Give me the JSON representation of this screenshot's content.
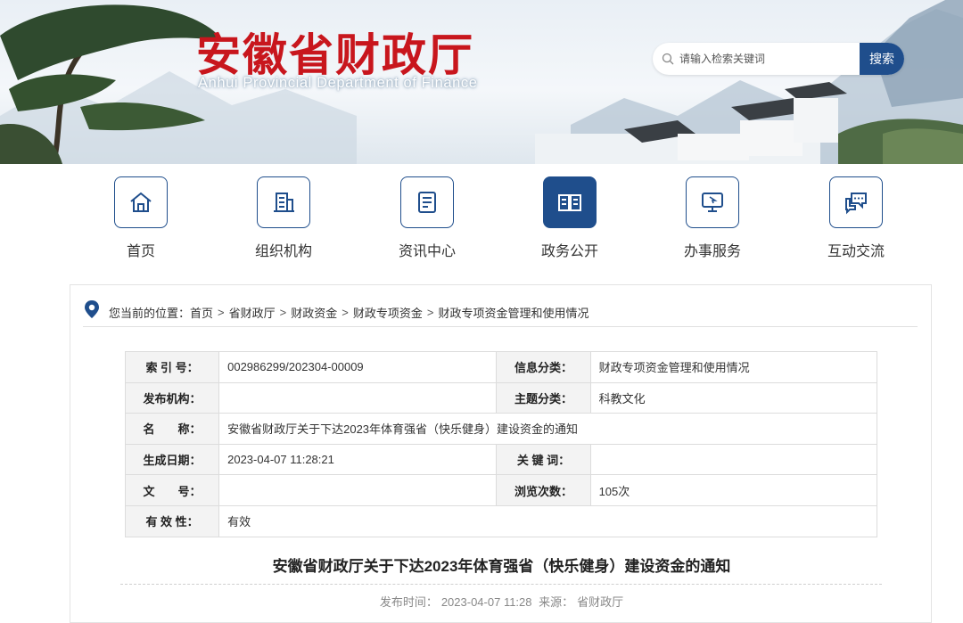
{
  "header": {
    "title": "安徽省财政厅",
    "subtitle": "Anhui Provincial Department of Finance",
    "search": {
      "placeholder": "请输入检索关键词",
      "button": "搜索"
    }
  },
  "nav": [
    {
      "label": "首页",
      "icon": "home-icon",
      "active": false
    },
    {
      "label": "组织机构",
      "icon": "building-icon",
      "active": false
    },
    {
      "label": "资讯中心",
      "icon": "news-icon",
      "active": false
    },
    {
      "label": "政务公开",
      "icon": "open-book-icon",
      "active": true
    },
    {
      "label": "办事服务",
      "icon": "monitor-icon",
      "active": false
    },
    {
      "label": "互动交流",
      "icon": "chat-icon",
      "active": false
    }
  ],
  "breadcrumb": {
    "prefix": "您当前的位置：",
    "items": [
      "首页",
      "省财政厅",
      "财政资金",
      "财政专项资金",
      "财政专项资金管理和使用情况"
    ],
    "separator": ">"
  },
  "meta_table": {
    "rows": [
      {
        "k1": "索 引 号：",
        "v1": "002986299/202304-00009",
        "k2": "信息分类：",
        "v2": "财政专项资金管理和使用情况"
      },
      {
        "k1": "发布机构：",
        "v1": "",
        "k2": "主题分类：",
        "v2": "科教文化"
      },
      {
        "k1": "名　　称：",
        "v1": "安徽省财政厅关于下达2023年体育强省（快乐健身）建设资金的通知"
      },
      {
        "k1": "生成日期：",
        "v1": "2023-04-07 11:28:21",
        "k2": "关 键 词：",
        "v2": ""
      },
      {
        "k1": "文　　号：",
        "v1": "",
        "k2": "浏览次数：",
        "v2": "105次"
      },
      {
        "k1": "有 效 性：",
        "v1": "有效"
      }
    ]
  },
  "article": {
    "title": "安徽省财政厅关于下达2023年体育强省（快乐健身）建设资金的通知",
    "published_label": "发布时间：",
    "published": "2023-04-07 11:28",
    "source_label": "来源：",
    "source": "省财政厅"
  },
  "colors": {
    "brand_red": "#c8161d",
    "brand_blue": "#1f4e8c"
  }
}
